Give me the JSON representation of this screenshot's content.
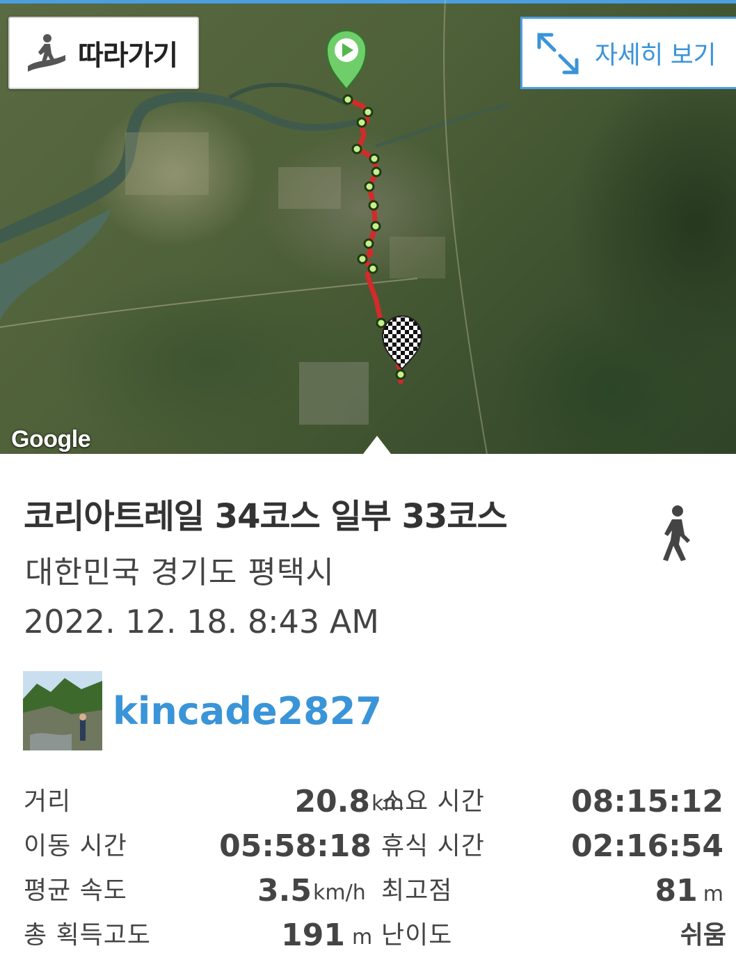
{
  "map": {
    "follow_button": {
      "label": "따라가기"
    },
    "detail_button": {
      "label": "자세히 보기"
    },
    "provider_logo": "Google",
    "route_color": "#d42a2a",
    "start_marker": "play-pin",
    "end_marker": "checkered-flag-pin"
  },
  "trail": {
    "title": "코리아트레일 34코스 일부 33코스",
    "location": "대한민국 경기도 평택시",
    "datetime": "2022. 12. 18. 8:43 AM",
    "activity_icon": "walking-person-icon"
  },
  "user": {
    "name": "kincade2827"
  },
  "stats": [
    {
      "label": "거리",
      "value": "20.8",
      "unit": "km",
      "label2": "소요 시간",
      "value2": "08:15:12",
      "unit2": ""
    },
    {
      "label": "이동 시간",
      "value": "05:58:18",
      "unit": "",
      "label2": "휴식 시간",
      "value2": "02:16:54",
      "unit2": ""
    },
    {
      "label": "평균 속도",
      "value": "3.5",
      "unit": "km/h",
      "label2": "최고점",
      "value2": "81",
      "unit2": "m"
    },
    {
      "label": "총 획득고도",
      "value": "191",
      "unit": "m",
      "label2": "난이도",
      "value2": "쉬움",
      "unit2": ""
    }
  ],
  "colors": {
    "accent": "#3a94d8",
    "text": "#444444"
  }
}
